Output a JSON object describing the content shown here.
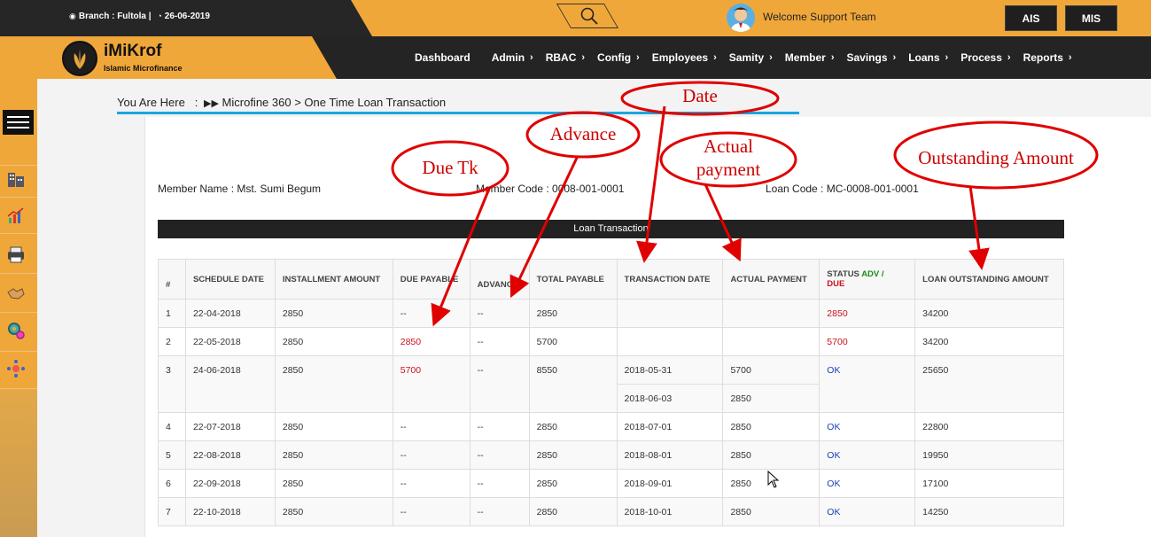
{
  "topbar": {
    "branch": "Branch : Fultola |",
    "date": "26-06-2019",
    "welcome": "Welcome Support Team",
    "buttons": [
      "AIS",
      "MIS"
    ]
  },
  "logo": {
    "name": "iMiKrof",
    "subtitle": "Islamic Microfinance"
  },
  "nav": {
    "items": [
      "Dashboard",
      "Admin",
      "RBAC",
      "Config",
      "Employees",
      "Samity",
      "Member",
      "Savings",
      "Loans",
      "Process",
      "Reports"
    ]
  },
  "breadcrumb": {
    "label": "You Are Here",
    "sep": ":",
    "path": "Microfine 360 > One Time Loan Transaction"
  },
  "member": {
    "name": "Member Name : Mst. Sumi Begum",
    "code": "Member Code : 0008-001-0001",
    "loan_code": "Loan Code : MC-0008-001-0001"
  },
  "table": {
    "title": "Loan Transaction",
    "headers": {
      "num": "#",
      "schedule_date": "SCHEDULE DATE",
      "installment": "INSTALLMENT AMOUNT",
      "due_payable": "DUE PAYABLE",
      "advance": "ADVANCE",
      "total_payable": "TOTAL PAYABLE",
      "transaction_date": "TRANSACTION DATE",
      "actual_payment": "ACTUAL PAYMENT",
      "status": "STATUS",
      "status_adv": "ADV /",
      "status_due": "DUE",
      "outstanding": "LOAN OUTSTANDING AMOUNT"
    },
    "rows": [
      {
        "num": "1",
        "date": "22-04-2018",
        "inst": "2850",
        "due": "--",
        "adv": "--",
        "total": "2850",
        "tdate": "",
        "pay": "",
        "status": "2850",
        "out": "34200"
      },
      {
        "num": "2",
        "date": "22-05-2018",
        "inst": "2850",
        "due": "2850",
        "adv": "--",
        "total": "5700",
        "tdate": "",
        "pay": "",
        "status": "5700",
        "out": "34200"
      },
      {
        "num": "3",
        "date": "24-06-2018",
        "inst": "2850",
        "due": "5700",
        "adv": "--",
        "total": "8550",
        "tdate": "2018-05-31",
        "pay": "5700",
        "tdate2": "2018-06-03",
        "pay2": "2850",
        "status": "OK",
        "out": "25650"
      },
      {
        "num": "4",
        "date": "22-07-2018",
        "inst": "2850",
        "due": "--",
        "adv": "--",
        "total": "2850",
        "tdate": "2018-07-01",
        "pay": "2850",
        "status": "OK",
        "out": "22800"
      },
      {
        "num": "5",
        "date": "22-08-2018",
        "inst": "2850",
        "due": "--",
        "adv": "--",
        "total": "2850",
        "tdate": "2018-08-01",
        "pay": "2850",
        "status": "OK",
        "out": "19950"
      },
      {
        "num": "6",
        "date": "22-09-2018",
        "inst": "2850",
        "due": "--",
        "adv": "--",
        "total": "2850",
        "tdate": "2018-09-01",
        "pay": "2850",
        "status": "OK",
        "out": "17100"
      },
      {
        "num": "7",
        "date": "22-10-2018",
        "inst": "2850",
        "due": "--",
        "adv": "--",
        "total": "2850",
        "tdate": "2018-10-01",
        "pay": "2850",
        "status": "OK",
        "out": "14250"
      }
    ]
  },
  "annotations": {
    "date": "Date",
    "advance": "Advance",
    "due_tk": "Due Tk",
    "actual_payment": "Actual payment",
    "outstanding": "Outstanding Amount"
  },
  "colors": {
    "accent": "#f0a73a",
    "dark": "#242424",
    "breadcrumb_line": "#1aa6df",
    "annotation": "#e00000"
  }
}
